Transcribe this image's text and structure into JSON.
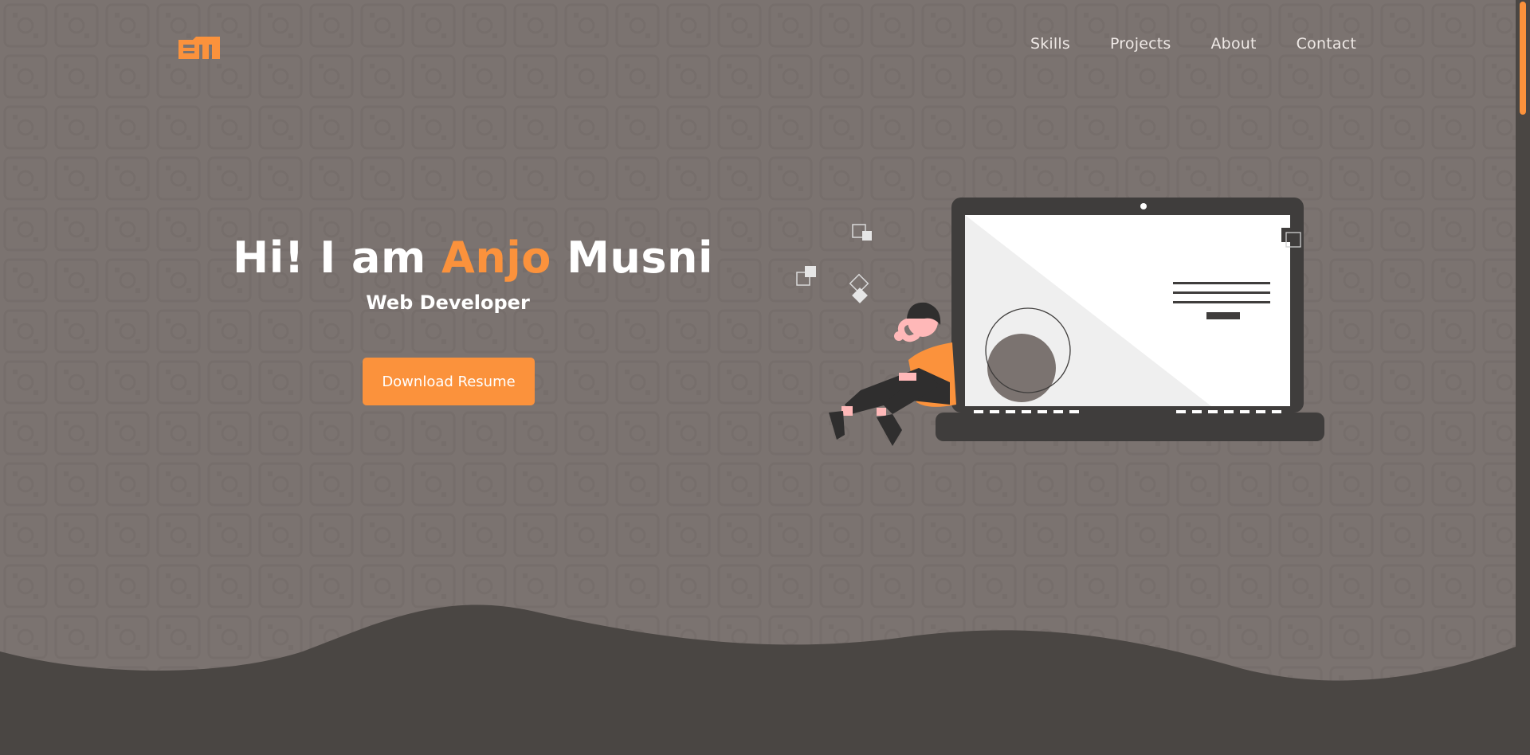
{
  "brand": {
    "logo_icon": "em-monogram-logo",
    "accent_color": "#fb923c",
    "background_color": "#7b7370",
    "dark_color": "#4a4643"
  },
  "nav": {
    "items": [
      {
        "label": "Skills"
      },
      {
        "label": "Projects"
      },
      {
        "label": "About"
      },
      {
        "label": "Contact"
      }
    ]
  },
  "hero": {
    "greeting": "Hi! I am ",
    "first_name": "Anjo",
    "last_name": " Musni",
    "subtitle": "Web Developer",
    "cta_label": "Download Resume"
  },
  "illustration": {
    "icon": "developer-with-laptop-illustration"
  }
}
